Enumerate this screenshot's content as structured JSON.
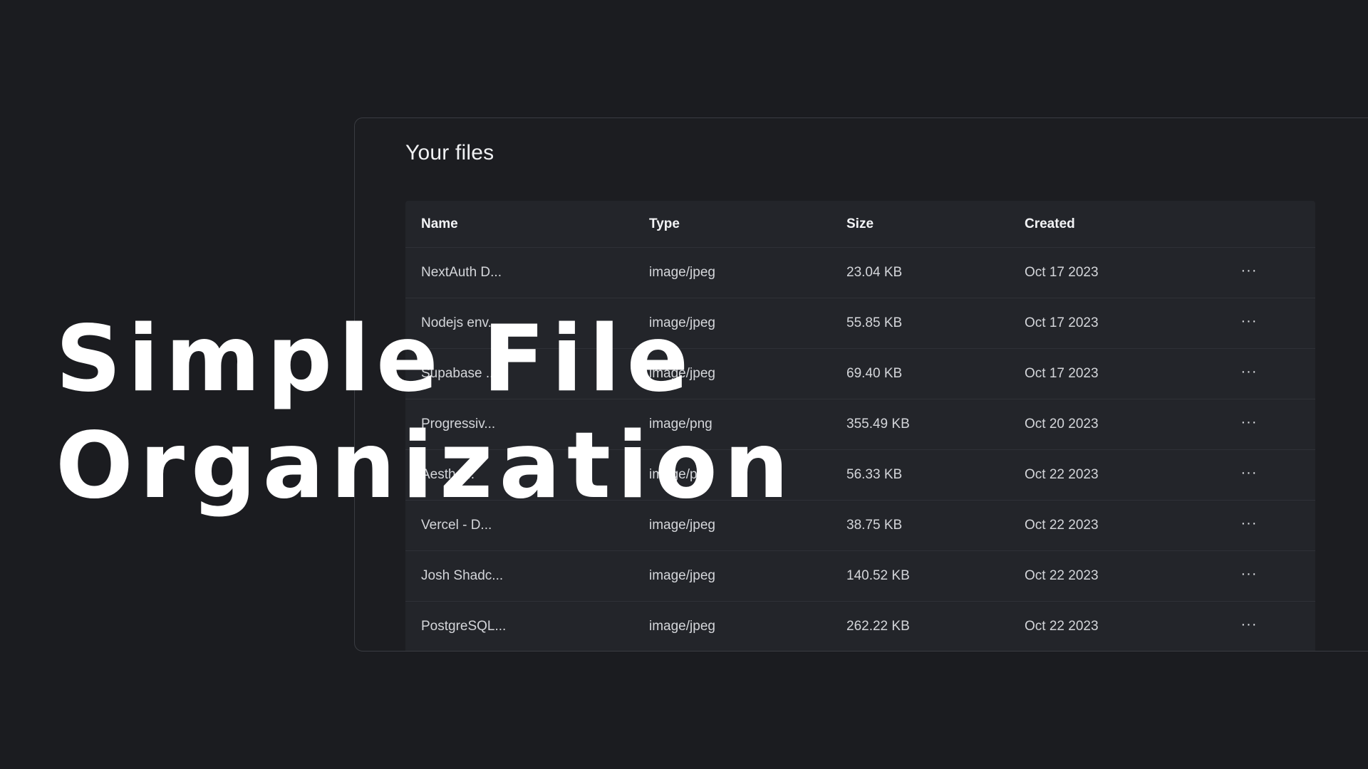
{
  "hero": {
    "line1": "Simple File",
    "line2": "Organization"
  },
  "files_panel": {
    "title": "Your files",
    "columns": {
      "name": "Name",
      "type": "Type",
      "size": "Size",
      "created": "Created"
    },
    "rows": [
      {
        "name": "NextAuth D...",
        "type": "image/jpeg",
        "size": "23.04 KB",
        "created": "Oct 17 2023",
        "actions": "···"
      },
      {
        "name": "Nodejs env...",
        "type": "image/jpeg",
        "size": "55.85 KB",
        "created": "Oct 17 2023",
        "actions": "···"
      },
      {
        "name": "Supabase ...",
        "type": "image/jpeg",
        "size": "69.40 KB",
        "created": "Oct 17 2023",
        "actions": "···"
      },
      {
        "name": "Progressiv...",
        "type": "image/png",
        "size": "355.49 KB",
        "created": "Oct 20 2023",
        "actions": "···"
      },
      {
        "name": "Aesthe...",
        "type": "image/png",
        "size": "56.33 KB",
        "created": "Oct 22 2023",
        "actions": "···"
      },
      {
        "name": "Vercel - D...",
        "type": "image/jpeg",
        "size": "38.75 KB",
        "created": "Oct 22 2023",
        "actions": "···"
      },
      {
        "name": "Josh Shadc...",
        "type": "image/jpeg",
        "size": "140.52 KB",
        "created": "Oct 22 2023",
        "actions": "···"
      },
      {
        "name": "PostgreSQL...",
        "type": "image/jpeg",
        "size": "262.22 KB",
        "created": "Oct 22 2023",
        "actions": "···"
      }
    ]
  },
  "colors": {
    "background": "#1b1c20",
    "panel": "#1c1d21",
    "table": "#23252a",
    "text": "#d4d6da",
    "hero_text": "#ffffff"
  },
  "icons": {
    "row_actions": "more-horizontal-icon"
  }
}
